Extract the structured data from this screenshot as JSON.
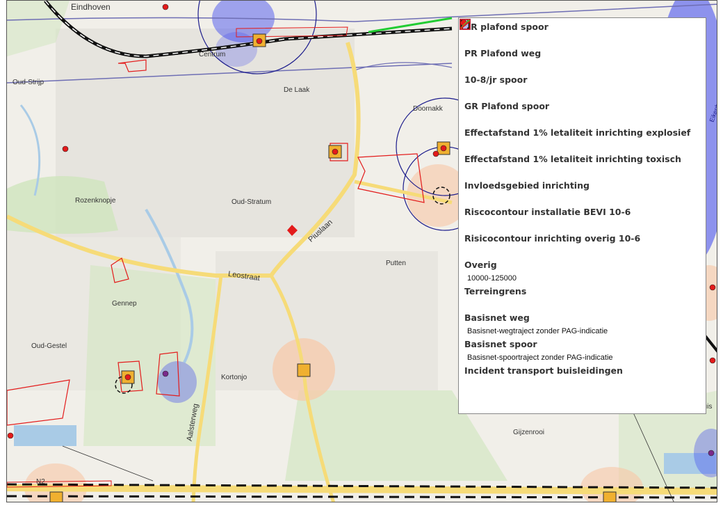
{
  "map": {
    "places": [
      {
        "id": "eindhoven",
        "name": "Eindhoven"
      },
      {
        "id": "oud-strijp",
        "name": "Oud-Strijp"
      },
      {
        "id": "centrum",
        "name": "Centrum"
      },
      {
        "id": "de-laak",
        "name": "De Laak"
      },
      {
        "id": "doornakkers",
        "name": "Doornakk"
      },
      {
        "id": "rozenknopje",
        "name": "Rozenknopje"
      },
      {
        "id": "oud-stratum",
        "name": "Oud-Stratum"
      },
      {
        "id": "putten",
        "name": "Putten"
      },
      {
        "id": "gennep",
        "name": "Gennep"
      },
      {
        "id": "oud-gestel",
        "name": "Oud-Gestel"
      },
      {
        "id": "kortonjo",
        "name": "Kortonjo"
      },
      {
        "id": "gijzenrooi",
        "name": "Gijzenrooi"
      },
      {
        "id": "nuis",
        "name": "nuis"
      },
      {
        "id": "eikenburg",
        "name": "Eikenburg"
      }
    ],
    "roads": {
      "piuslaan": "Piuslaan",
      "leostraat": "Leostraat",
      "aalsterweg": "Aalsterweg",
      "n2": "N2"
    }
  },
  "legend": {
    "items": [
      {
        "key": "pr_plafond_spoor",
        "title": "PR plafond spoor",
        "symbol": "bracket-black"
      },
      {
        "key": "pr_plafond_weg",
        "title": "PR Plafond weg",
        "symbol": "bracket-black"
      },
      {
        "key": "spoor_10_8",
        "title": "10-8/jr spoor",
        "symbol": "box-purple"
      },
      {
        "key": "gr_plafond_spoor",
        "title": "GR Plafond spoor",
        "symbol": "bracket-corner"
      },
      {
        "key": "effect_explosief",
        "title": "Effectafstand 1% letaliteit inrichting explosief",
        "symbol": "fill-peach"
      },
      {
        "key": "effect_toxisch",
        "title": "Effectafstand 1% letaliteit inrichting toxisch",
        "symbol": "fill-lavender"
      },
      {
        "key": "invloedsgebied",
        "title": "Invloedsgebied inrichting",
        "symbol": "box-navy"
      },
      {
        "key": "risico_bevi",
        "title": "Riscocontour installatie BEVI 10-6",
        "symbol": "bracket-dashed"
      },
      {
        "key": "risico_overig",
        "title": "Risicocontour inrichting overig 10-6",
        "symbol": "bracket-dashed"
      },
      {
        "key": "overig",
        "title": "Overig",
        "symbol": "red-dot",
        "sub": "10000-125000"
      },
      {
        "key": "terreingrens",
        "title": "Terreingrens",
        "symbol": "box-red"
      },
      {
        "key": "basisnet_weg",
        "title": "Basisnet weg",
        "symbol": "line-yellow",
        "sub": "Basisnet-wegtraject zonder PAG-indicatie"
      },
      {
        "key": "basisnet_spoor",
        "title": "Basisnet spoor",
        "symbol": "line-green",
        "sub": "Basisnet-spoortraject zonder PAG-indicatie"
      },
      {
        "key": "incident_buis",
        "title": "Incident transport buisleidingen",
        "symbol": "line-red"
      }
    ]
  },
  "colors": {
    "map_bg": "#f1efe9",
    "main_road": "#f6db78",
    "rail": "#111111",
    "red_contour": "#e31b1b",
    "purple_contour": "#6e6eb4",
    "navy_contour": "#1c1c8c",
    "blue_toxic": "#3a45f0",
    "peach_explosive": "#f8c7a6",
    "green_area": "#cfe5bd",
    "water": "#a9cbe6",
    "green_rail": "#22cc33"
  }
}
